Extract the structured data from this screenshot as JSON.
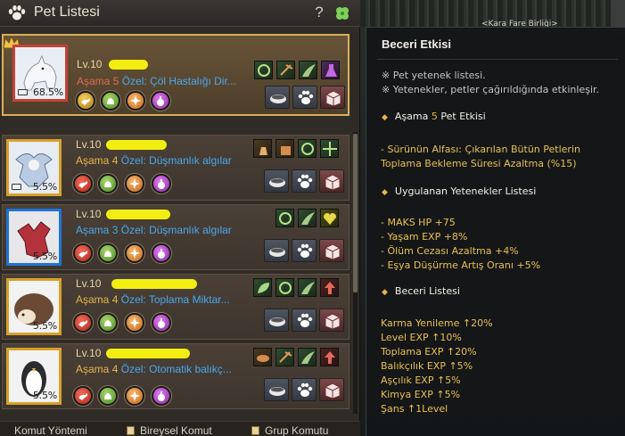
{
  "window": {
    "title": "Pet Listesi",
    "help": "?"
  },
  "pets": [
    {
      "lv_label": "Lv.",
      "lv_value": "10",
      "stage_label": "Aşama",
      "stage_value": "5",
      "ozel_label": "Özel:",
      "ozel_value": "Çöl Hastalığı Dir...",
      "percent": "68.5%",
      "animal": "wolf",
      "stage_color": "red"
    },
    {
      "lv_label": "Lv.",
      "lv_value": "10",
      "stage_label": "Aşama",
      "stage_value": "4",
      "ozel_label": "Özel:",
      "ozel_value": "Düşmanlık algılar",
      "percent": "5.5%",
      "animal": "griffin"
    },
    {
      "lv_label": "Lv.",
      "lv_value": "10",
      "stage_label": "Aşama",
      "stage_value": "3",
      "ozel_label": "Özel:",
      "ozel_value": "Düşmanlık algılar",
      "percent": "5.5%",
      "animal": "dragon",
      "stage_color": "blue"
    },
    {
      "lv_label": "Lv.",
      "lv_value": "10",
      "stage_label": "Aşama",
      "stage_value": "4",
      "ozel_label": "Özel:",
      "ozel_value": "Toplama Miktar...",
      "percent": "5.5%",
      "animal": "hedgehog"
    },
    {
      "lv_label": "Lv.",
      "lv_value": "10",
      "stage_label": "Aşama",
      "stage_value": "4",
      "ozel_label": "Özel:",
      "ozel_value": "Otomatik balıkç...",
      "percent": "5.5%",
      "animal": "penguin"
    }
  ],
  "footer": {
    "items": [
      "Komut Yöntemi",
      "Bireysel Komut",
      "Grup Komutu"
    ]
  },
  "scene": {
    "guild_label": "<Kara Fare Birliği>"
  },
  "tooltip": {
    "title": "Beceri Etkisi",
    "notes": [
      "※ Pet yetenek listesi.",
      "※ Yetenekler, petler çağırıldığında etkinleşir."
    ],
    "sections": {
      "stage_effect_prefix": "Aşama",
      "stage_effect_value": "5",
      "stage_effect_suffix": "Pet Etkisi",
      "stage_effect_lines": [
        "- Sürünün Alfası: Çıkarılan Bütün Petlerin",
        "Toplama Bekleme Süresi Azaltma (%15)"
      ],
      "applied_title": "Uygulanan Yetenekler Listesi",
      "applied": [
        "- MAKS HP +75",
        "- Yaşam EXP +8%",
        "- Ölüm Cezası Azaltma +4%",
        "- Eşya Düşürme Artış Oranı +5%"
      ],
      "skill_list_title": "Beceri Listesi",
      "skills": [
        "Karma Yenileme ↑20%",
        "Level EXP ↑10%",
        "Toplama EXP ↑20%",
        "Balıkçılık EXP ↑5%",
        "Aşçılık EXP ↑5%",
        "Kimya EXP ↑5%",
        "Şans ↑1Level"
      ]
    }
  },
  "colors": {
    "accent_gold": "#e8b54a",
    "stage_red": "#e06a4e",
    "blue_text": "#4aa8ee",
    "selected_border": "#d9b05c"
  }
}
